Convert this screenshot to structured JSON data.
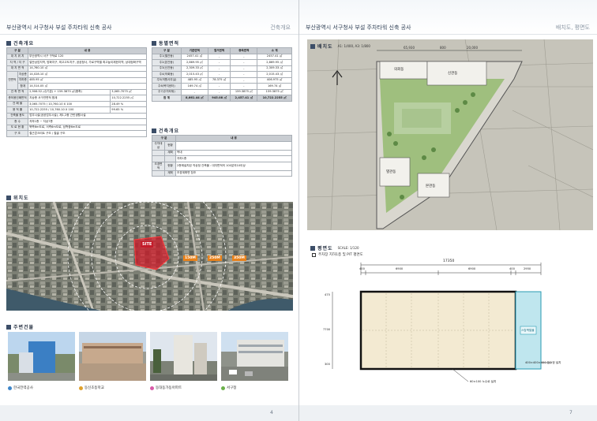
{
  "left_page": {
    "header_title": "부산광역시 서구청사 부설 주차타워 신축 공사",
    "header_section": "건축개요",
    "page_number": "4",
    "overview": {
      "title": "건축개요",
      "head": [
        "구 분",
        "내 용"
      ],
      "rows": [
        [
          "대 지 위 치",
          "부산광역시 서구 구덕로 120"
        ],
        [
          "지 역 / 지 구",
          "일반상업지역, 방화지구, 최고고도지구, 공공청사, 가로구역별 최고높이제한지역, 상대정화구역"
        ],
        [
          "대 지 면 적",
          "14,760.10 ㎡"
        ],
        [
          "지상층",
          "14,028.10 ㎡"
        ],
        [
          "지하층",
          "485.95 ㎡"
        ],
        [
          "합계",
          "14,514.05 ㎡"
        ],
        [
          "건 축 면 적",
          "2,906.52 ㎡(기존) + 159.3875 ㎡(증축)",
          "3,065.7075 ㎡"
        ],
        [
          "총허용건폐면적",
          "지상층 서구연면적 합계",
          "10,722.2255 ㎡"
        ],
        [
          "건 폐 율",
          "3,065.7075 / 10,760.10 X 100",
          "28.49 %"
        ],
        [
          "용 적 률",
          "10,722.2255 / 10,760.10 X 100",
          "99.65 %"
        ],
        [
          "건축물 용도",
          "업무시설(공공업무시설), 제1,2종 근린생활시설"
        ],
        [
          "층 수",
          "지하1층 ~ 지상7층"
        ],
        [
          "도 로 현 황",
          "북측6m도로, 서측6m도로, 남측중6m도로"
        ],
        [
          "구 조",
          "철근콘크리트 구조 / 철골 구조"
        ]
      ],
      "group_label": "연면적"
    },
    "floor_area": {
      "title": "동별면적",
      "head": [
        "구 분",
        "기존면적",
        "철거면적",
        "증축면적",
        "소 계"
      ],
      "rows": [
        [
          "주1(별관동)",
          "2457.41 ㎡",
          "-",
          "-",
          "2457.41 ㎡"
        ],
        [
          "주2(본관동)",
          "2,869.95 ㎡",
          "-",
          "-",
          "2,869.95 ㎡"
        ],
        [
          "주3(신관동)",
          "2,309.33 ㎡",
          "-",
          "-",
          "2,309.33 ㎡"
        ],
        [
          "주4(의회동)",
          "2,015.43 ㎡",
          "-",
          "-",
          "2,015.43 ㎡"
        ],
        [
          "주5(의원사무실)",
          "485.95 ㎡",
          "78.375 ㎡",
          "-",
          "406.975 ㎡"
        ],
        [
          "주6(복지센터)",
          "169.74 ㎡",
          "-",
          "-",
          "169.74 ㎡"
        ],
        [
          "주7(주차타워)",
          "-",
          "-",
          "159.3875 ㎡",
          "159.3875 ㎡"
        ],
        [
          "합 계",
          "8,661.44 ㎡",
          "945.08 ㎡",
          "2,457.41 ㎡",
          "10,722.2255 ㎡"
        ]
      ]
    },
    "building_overview": {
      "title": "건축개요",
      "head": [
        "구 분",
        "내 용"
      ],
      "rows": [
        [
          "주차대상",
          "현황",
          ""
        ],
        [
          "",
          "계획",
          "옥내"
        ],
        [
          "",
          "",
          "지하1층"
        ],
        [
          "조경면적",
          "현황",
          "2층에설치된 직상정 건축물 : 대지면적의 100분의10이상"
        ],
        [
          "",
          "계획",
          "조경계획면 참조"
        ]
      ]
    },
    "location": {
      "title": "위치도",
      "site_label": "SITE",
      "radii": [
        "150M",
        "250M",
        "350M"
      ]
    },
    "nearby": {
      "title": "주변건물",
      "items": [
        {
          "label": "한국전력공사",
          "color": "#3e86c9"
        },
        {
          "label": "동신초등학교",
          "color": "#e0a12b"
        },
        {
          "label": "동대동가동아파트",
          "color": "#d85aa8"
        },
        {
          "label": "서구청",
          "color": "#6bb04a"
        }
      ]
    }
  },
  "right_page": {
    "header_title": "부산광역시 서구청사 부설 주차타워 신축 공사",
    "header_section": "배치도, 평면도",
    "page_number": "7",
    "site_plan": {
      "title": "배치도",
      "scale": "A1: 1/400, A3: 1/800",
      "dims_top": [
        "65,930",
        "800",
        "20,000"
      ],
      "labels": [
        "의회동",
        "신관동",
        "본관동",
        "별관동"
      ]
    },
    "floor_plan": {
      "title": "평면도",
      "scale": "SCALE: 1/120",
      "subtitle": "주차장 지하1층 및 PIT 평면도",
      "dims_overall": "17350",
      "dims_parts": [
        "400",
        "6900",
        "6900",
        "400",
        "2950"
      ],
      "dims_left": [
        "475",
        "7700",
        "300"
      ],
      "stair_label": "스탑벽철물",
      "note_right": "400×400×400 집수정 설치",
      "note_bottom": "60×100 노수로 설치"
    }
  }
}
